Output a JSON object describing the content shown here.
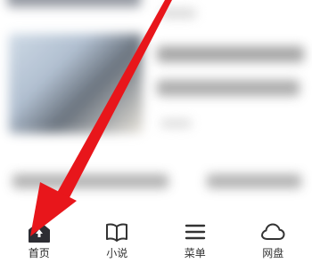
{
  "colors": {
    "accent": "#e8161b",
    "tab_icon": "#333333",
    "tab_icon_active": "#2d2d33"
  },
  "tabbar": {
    "items": [
      {
        "label": "首页",
        "icon": "home-icon",
        "active": true
      },
      {
        "label": "小说",
        "icon": "book-icon",
        "active": false
      },
      {
        "label": "菜单",
        "icon": "menu-icon",
        "active": false
      },
      {
        "label": "网盘",
        "icon": "cloud-icon",
        "active": false
      }
    ]
  },
  "annotation": {
    "icon": "red-arrow-pointer",
    "target": "首页"
  }
}
